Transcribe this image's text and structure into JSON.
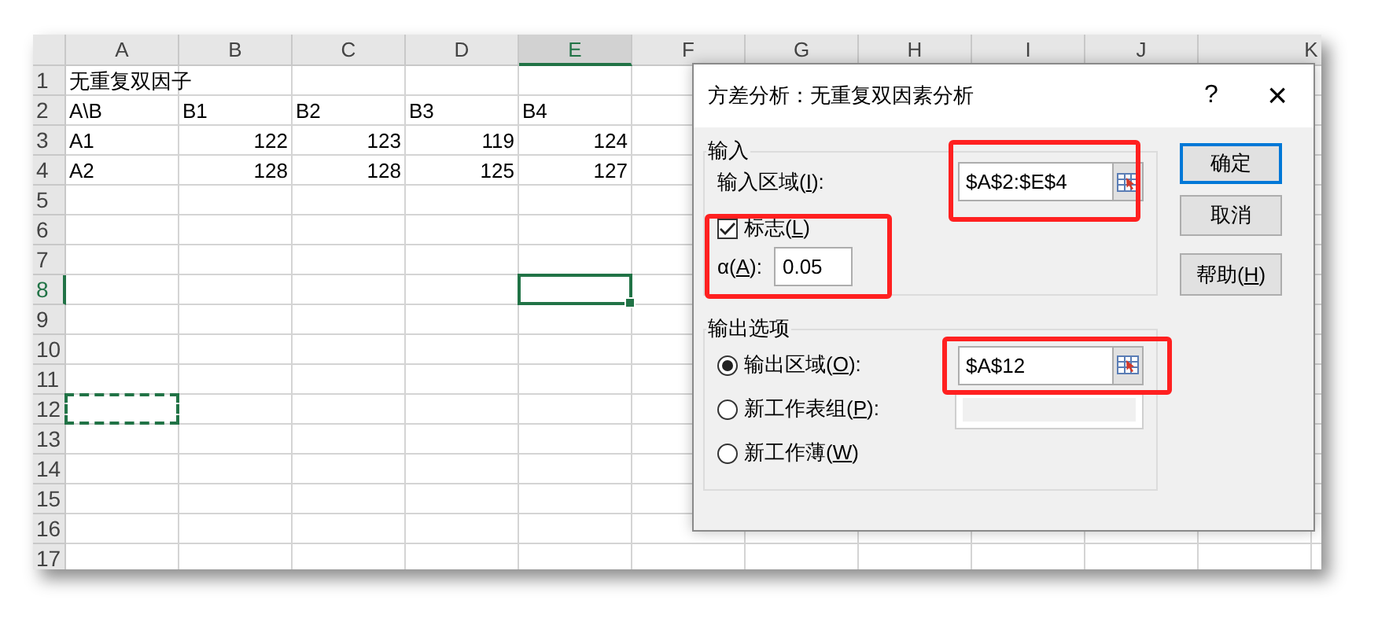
{
  "sheet": {
    "columns": [
      {
        "label": "A",
        "selected": false
      },
      {
        "label": "B",
        "selected": false
      },
      {
        "label": "C",
        "selected": false
      },
      {
        "label": "D",
        "selected": false
      },
      {
        "label": "E",
        "selected": true
      },
      {
        "label": "F",
        "selected": false
      },
      {
        "label": "G",
        "selected": false
      },
      {
        "label": "H",
        "selected": false
      },
      {
        "label": "I",
        "selected": false
      },
      {
        "label": "J",
        "selected": false
      },
      {
        "label": "K",
        "selected": false
      }
    ],
    "rows": [
      {
        "label": "1",
        "selected": false,
        "cells": [
          {
            "kind": "text",
            "text": "无重复双因子"
          }
        ]
      },
      {
        "label": "2",
        "selected": false,
        "cells": [
          {
            "kind": "text",
            "text": "A\\B"
          },
          {
            "kind": "text",
            "text": "B1"
          },
          {
            "kind": "text",
            "text": "B2"
          },
          {
            "kind": "text",
            "text": "B3"
          },
          {
            "kind": "text",
            "text": "B4"
          }
        ]
      },
      {
        "label": "3",
        "selected": false,
        "cells": [
          {
            "kind": "text",
            "text": "A1"
          },
          {
            "kind": "number",
            "text": "122"
          },
          {
            "kind": "number",
            "text": "123"
          },
          {
            "kind": "number",
            "text": "119"
          },
          {
            "kind": "number",
            "text": "124"
          }
        ]
      },
      {
        "label": "4",
        "selected": false,
        "cells": [
          {
            "kind": "text",
            "text": "A2"
          },
          {
            "kind": "number",
            "text": "128"
          },
          {
            "kind": "number",
            "text": "128"
          },
          {
            "kind": "number",
            "text": "125"
          },
          {
            "kind": "number",
            "text": "127"
          }
        ]
      },
      {
        "label": "5",
        "selected": false
      },
      {
        "label": "6",
        "selected": false
      },
      {
        "label": "7",
        "selected": false
      },
      {
        "label": "8",
        "selected": true,
        "cells": [
          {
            "kind": "empty"
          },
          {
            "kind": "empty"
          },
          {
            "kind": "empty"
          },
          {
            "kind": "empty"
          },
          {
            "kind": "empty",
            "active": true
          }
        ]
      },
      {
        "label": "9",
        "selected": false
      },
      {
        "label": "10",
        "selected": false
      },
      {
        "label": "11",
        "selected": false
      },
      {
        "label": "12",
        "selected": false,
        "cells": [
          {
            "kind": "empty",
            "copy_marquee": true
          }
        ]
      },
      {
        "label": "13",
        "selected": false
      },
      {
        "label": "14",
        "selected": false
      },
      {
        "label": "15",
        "selected": false
      },
      {
        "label": "16",
        "selected": false
      },
      {
        "label": "17",
        "selected": false
      }
    ]
  },
  "dialog": {
    "title": "方差分析：无重复双因素分析",
    "help_glyph": "?",
    "close_glyph": "×",
    "input_group": {
      "legend": "输入",
      "range_label": [
        "输入区域(",
        "I",
        "):"
      ],
      "range_value": "$A$2:$E$4",
      "range_highlighted": true,
      "labels_checkbox": {
        "label": [
          "标志(",
          "L",
          ")"
        ],
        "checked": true
      },
      "alpha_label": [
        "α(",
        "A",
        "):"
      ],
      "alpha_value": "0.05",
      "options_highlighted": true
    },
    "output_group": {
      "legend": "输出选项",
      "options": [
        {
          "label": [
            "输出区域(",
            "O",
            "):"
          ],
          "selected": true,
          "field": {
            "value": "$A$12",
            "disabled": false,
            "highlighted": true
          }
        },
        {
          "label": [
            "新工作表组(",
            "P",
            "):"
          ],
          "selected": false,
          "field": {
            "disabled": true,
            "highlighted": false
          }
        },
        {
          "label": [
            "新工作薄(",
            "W",
            ")"
          ],
          "selected": false
        }
      ]
    },
    "buttons": [
      {
        "label": [
          "确定"
        ],
        "default": true
      },
      {
        "label": [
          "取消"
        ],
        "default": false
      },
      {
        "label": [
          "帮助(",
          "H",
          ")"
        ],
        "default": false
      }
    ]
  }
}
